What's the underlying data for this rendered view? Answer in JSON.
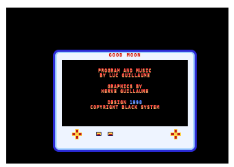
{
  "screen": {
    "title": "GOOD MOON",
    "credits": {
      "program_line1": "PROGRAM AND MUSIC",
      "program_line2": "BY LUC GUILLAUME",
      "graphics_line1": "GRAPHICS BY",
      "graphics_line2": "HERVE GUILLAUME",
      "design_label": "DESIGN",
      "design_year": "1990",
      "copyright": "COPYRIGHT BLACK SYSTEM"
    }
  },
  "colors": {
    "background": "#000000",
    "frame_rim": "#2b2bd6",
    "frame_bezel": "#eef4ff",
    "text_red": "#ff3a3a",
    "text_yellow": "#ffd24a",
    "text_blue": "#3a6bff"
  },
  "icons": {
    "left_button": "plus-cross-icon",
    "right_button": "plus-cross-icon",
    "mini_buttons": [
      "small-block-icon",
      "small-block-icon"
    ]
  }
}
